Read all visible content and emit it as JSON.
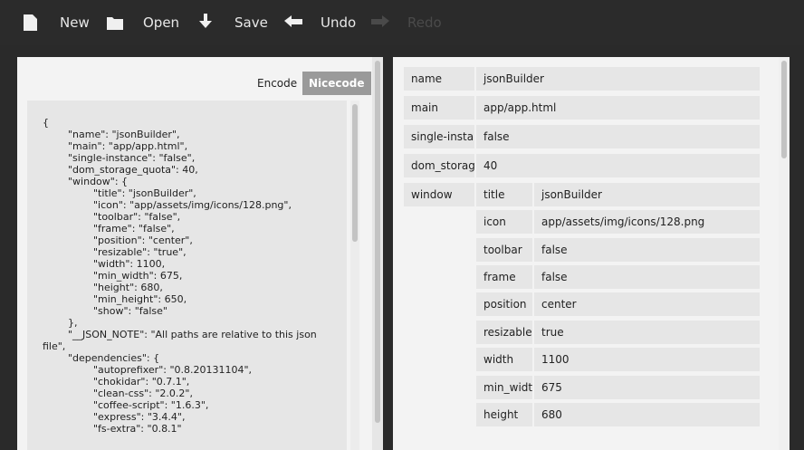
{
  "toolbar": {
    "new_label": "New",
    "open_label": "Open",
    "save_label": "Save",
    "undo_label": "Undo",
    "redo_label": "Redo",
    "text_color": "#e8e8e8",
    "disabled_color": "#4a4a4a"
  },
  "left": {
    "encode_label": "Encode",
    "nicecode_label": "Nicecode",
    "code": "{\n        \"name\": \"jsonBuilder\",\n        \"main\": \"app/app.html\",\n        \"single-instance\": \"false\",\n        \"dom_storage_quota\": 40,\n        \"window\": {\n                \"title\": \"jsonBuilder\",\n                \"icon\": \"app/assets/img/icons/128.png\",\n                \"toolbar\": \"false\",\n                \"frame\": \"false\",\n                \"position\": \"center\",\n                \"resizable\": \"true\",\n                \"width\": 1100,\n                \"min_width\": 675,\n                \"height\": 680,\n                \"min_height\": 650,\n                \"show\": \"false\"\n        },\n        \"__JSON_NOTE\": \"All paths are relative to this json file\",\n        \"dependencies\": {\n                \"autoprefixer\": \"0.8.20131104\",\n                \"chokidar\": \"0.7.1\",\n                \"clean-css\": \"2.0.2\",\n                \"coffee-script\": \"1.6.3\",\n                \"express\": \"3.4.4\",\n                \"fs-extra\": \"0.8.1\""
  },
  "right": {
    "rows": [
      {
        "key": "name",
        "value": "jsonBuilder"
      },
      {
        "key": "main",
        "value": "app/app.html"
      },
      {
        "key": "single-instance",
        "value": "false"
      },
      {
        "key": "dom_storage_quota",
        "value": "40"
      }
    ],
    "window_key": "window",
    "window_rows": [
      {
        "key": "title",
        "value": "jsonBuilder"
      },
      {
        "key": "icon",
        "value": "app/assets/img/icons/128.png"
      },
      {
        "key": "toolbar",
        "value": "false"
      },
      {
        "key": "frame",
        "value": "false"
      },
      {
        "key": "position",
        "value": "center"
      },
      {
        "key": "resizable",
        "value": "true"
      },
      {
        "key": "width",
        "value": "1100"
      },
      {
        "key": "min_width",
        "value": "675"
      },
      {
        "key": "height",
        "value": "680"
      }
    ]
  }
}
